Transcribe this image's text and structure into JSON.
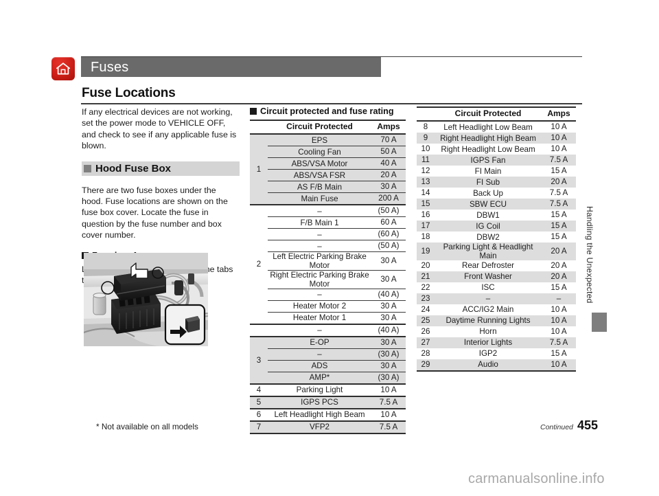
{
  "header": {
    "home_icon": "home-icon",
    "title": "Fuses"
  },
  "section": {
    "title": "Fuse Locations",
    "intro": "If any electrical devices are not working, set the power mode to VEHICLE OFF, and check to see if any applicable fuse is blown.",
    "hood_fuse_box_heading": "Hood Fuse Box",
    "hood_fuse_box_body": "There are two fuse boxes under the hood. Fuse locations are shown on the fuse box cover. Locate the fuse in question by the fuse number and box cover number.",
    "fuse_box_a_heading": "Fuse box A",
    "fuse_box_a_body": "Located near the radiator. Push the tabs to open the box."
  },
  "figure": {
    "caption": "engine-bay-fuse-box-illustration",
    "inset": "push-tab-detail"
  },
  "table_heading": "Circuit protected and fuse rating",
  "columns": {
    "circuit_protected": "Circuit Protected",
    "amps": "Amps"
  },
  "table_left": [
    {
      "no": "1",
      "span": 6,
      "shade": true,
      "rows": [
        {
          "circuit": "EPS",
          "amps": "70 A"
        },
        {
          "circuit": "Cooling Fan",
          "amps": "50 A"
        },
        {
          "circuit": "ABS/VSA Motor",
          "amps": "40 A"
        },
        {
          "circuit": "ABS/VSA FSR",
          "amps": "20 A"
        },
        {
          "circuit": "AS F/B Main",
          "amps": "30 A"
        },
        {
          "circuit": "Main Fuse",
          "amps": "200 A"
        }
      ]
    },
    {
      "no": "2",
      "span": 9,
      "shade": false,
      "rows": [
        {
          "circuit": "–",
          "amps": "(50 A)"
        },
        {
          "circuit": "F/B Main 1",
          "amps": "60 A"
        },
        {
          "circuit": "–",
          "amps": "(60 A)"
        },
        {
          "circuit": "–",
          "amps": "(50 A)"
        },
        {
          "circuit": "Left Electric Parking Brake Motor",
          "amps": "30 A"
        },
        {
          "circuit": "Right Electric Parking Brake Motor",
          "amps": "30 A"
        },
        {
          "circuit": "–",
          "amps": "(40 A)"
        },
        {
          "circuit": "Heater Motor 2",
          "amps": "30 A"
        },
        {
          "circuit": "Heater Motor 1",
          "amps": "30 A"
        }
      ]
    },
    {
      "no": "",
      "span": 1,
      "shade": false,
      "rows": [
        {
          "circuit": "–",
          "amps": "(40 A)"
        }
      ]
    },
    {
      "no": "3",
      "span": 4,
      "shade": true,
      "rows": [
        {
          "circuit": "E-OP",
          "amps": "30 A"
        },
        {
          "circuit": "–",
          "amps": "(30 A)"
        },
        {
          "circuit": "ADS",
          "amps": "30 A"
        },
        {
          "circuit": "AMP*",
          "amps": "(30 A)"
        }
      ]
    },
    {
      "no": "4",
      "span": 1,
      "shade": false,
      "rows": [
        {
          "circuit": "Parking Light",
          "amps": "10 A"
        }
      ]
    },
    {
      "no": "5",
      "span": 1,
      "shade": true,
      "rows": [
        {
          "circuit": "IGPS PCS",
          "amps": "7.5 A"
        }
      ]
    },
    {
      "no": "6",
      "span": 1,
      "shade": false,
      "rows": [
        {
          "circuit": "Left Headlight High Beam",
          "amps": "10 A"
        }
      ]
    },
    {
      "no": "7",
      "span": 1,
      "shade": true,
      "rows": [
        {
          "circuit": "VFP2",
          "amps": "7.5 A"
        }
      ]
    }
  ],
  "table_right": [
    {
      "no": "8",
      "circuit": "Left Headlight Low Beam",
      "amps": "10 A",
      "shade": false
    },
    {
      "no": "9",
      "circuit": "Right Headlight High Beam",
      "amps": "10 A",
      "shade": true
    },
    {
      "no": "10",
      "circuit": "Right Headlight Low Beam",
      "amps": "10 A",
      "shade": false
    },
    {
      "no": "11",
      "circuit": "IGPS Fan",
      "amps": "7.5 A",
      "shade": true
    },
    {
      "no": "12",
      "circuit": "FI Main",
      "amps": "15 A",
      "shade": false
    },
    {
      "no": "13",
      "circuit": "FI Sub",
      "amps": "20 A",
      "shade": true
    },
    {
      "no": "14",
      "circuit": "Back Up",
      "amps": "7.5 A",
      "shade": false
    },
    {
      "no": "15",
      "circuit": "SBW ECU",
      "amps": "7.5 A",
      "shade": true
    },
    {
      "no": "16",
      "circuit": "DBW1",
      "amps": "15 A",
      "shade": false
    },
    {
      "no": "17",
      "circuit": "IG Coil",
      "amps": "15 A",
      "shade": true
    },
    {
      "no": "18",
      "circuit": "DBW2",
      "amps": "15 A",
      "shade": false
    },
    {
      "no": "19",
      "circuit": "Parking Light & Headlight Main",
      "amps": "20 A",
      "shade": true
    },
    {
      "no": "20",
      "circuit": "Rear Defroster",
      "amps": "20 A",
      "shade": false
    },
    {
      "no": "21",
      "circuit": "Front Washer",
      "amps": "20 A",
      "shade": true
    },
    {
      "no": "22",
      "circuit": "ISC",
      "amps": "15 A",
      "shade": false
    },
    {
      "no": "23",
      "circuit": "–",
      "amps": "–",
      "shade": true
    },
    {
      "no": "24",
      "circuit": "ACC/IG2 Main",
      "amps": "10 A",
      "shade": false
    },
    {
      "no": "25",
      "circuit": "Daytime Running Lights",
      "amps": "10 A",
      "shade": true
    },
    {
      "no": "26",
      "circuit": "Horn",
      "amps": "10 A",
      "shade": false
    },
    {
      "no": "27",
      "circuit": "Interior Lights",
      "amps": "7.5 A",
      "shade": true
    },
    {
      "no": "28",
      "circuit": "IGP2",
      "amps": "15 A",
      "shade": false
    },
    {
      "no": "29",
      "circuit": "Audio",
      "amps": "10 A",
      "shade": true
    }
  ],
  "side_tab": {
    "label": "Handling the Unexpected"
  },
  "footer": {
    "footnote": "* Not available on all models",
    "continued": "Continued",
    "page_number": "455",
    "watermark": "carmanualsonline.info"
  },
  "colors": {
    "title_bar": "#6a6a6a",
    "home_icon": "#cc1f17",
    "band": "#d4d4d4",
    "row_shade": "#dddddd",
    "rule": "#2e2e2e"
  }
}
